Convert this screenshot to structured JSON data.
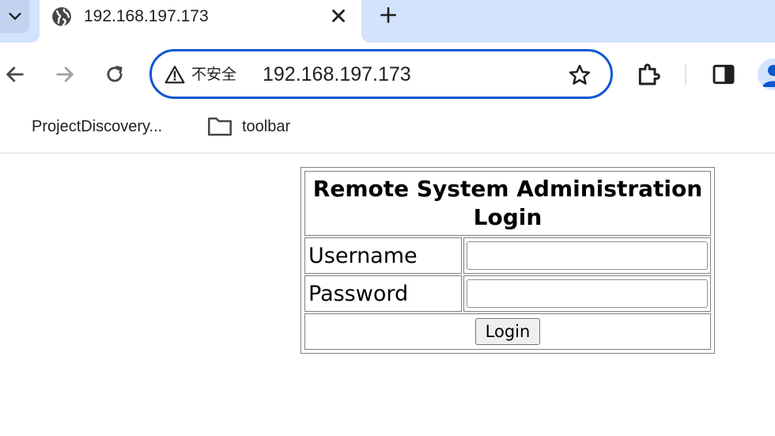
{
  "browser": {
    "tab": {
      "title": "192.168.197.173"
    },
    "omnibox": {
      "security_label": "不安全",
      "url": "192.168.197.173"
    },
    "bookmarks": [
      {
        "label": "ProjectDiscovery..."
      },
      {
        "label": "toolbar"
      }
    ],
    "accent_color": "#0b57d0",
    "tabstrip_color": "#d3e3fd"
  },
  "page": {
    "login": {
      "title": "Remote System Administration Login",
      "username_label": "Username",
      "username_value": "",
      "password_label": "Password",
      "password_value": "",
      "submit_label": "Login"
    }
  }
}
